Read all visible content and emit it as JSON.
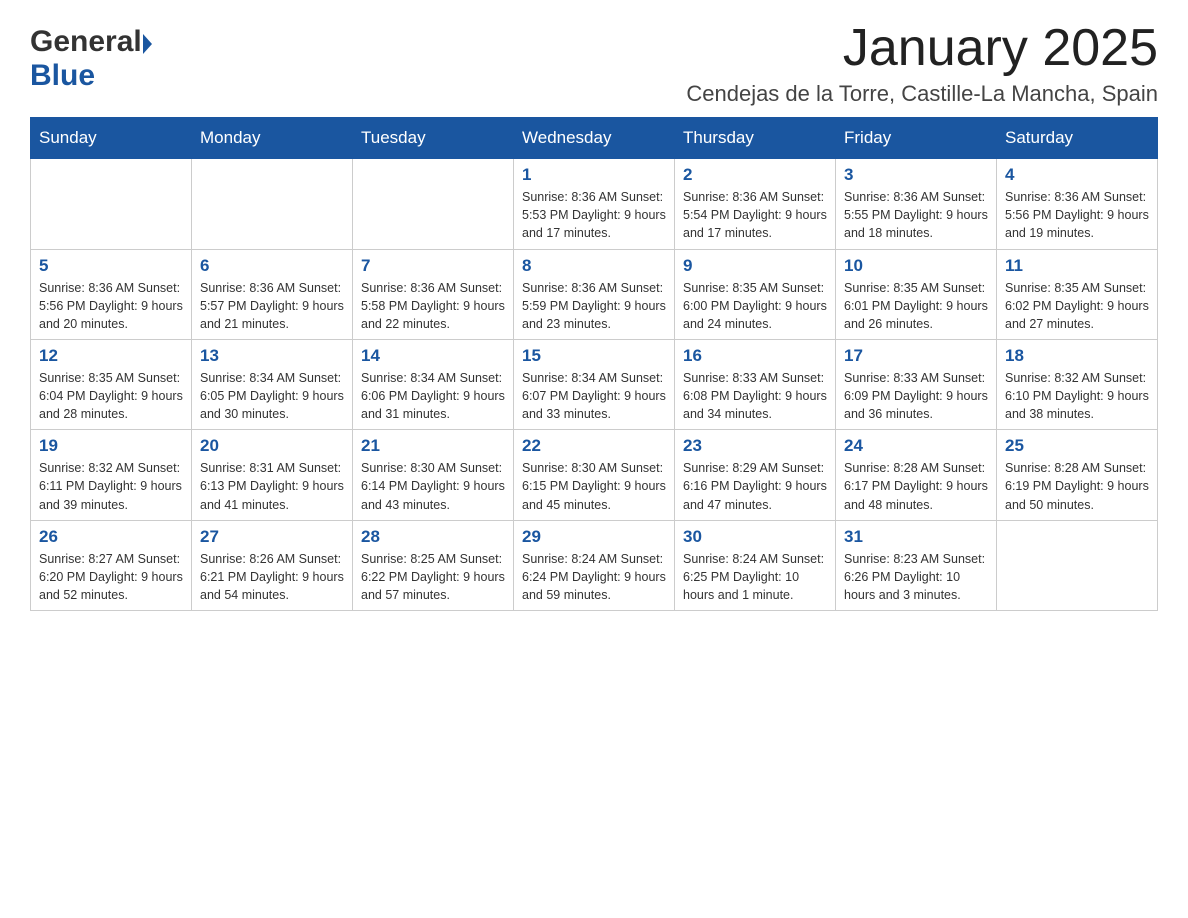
{
  "header": {
    "logo_general": "General",
    "logo_blue": "Blue",
    "month_title": "January 2025",
    "location": "Cendejas de la Torre, Castille-La Mancha, Spain"
  },
  "days_of_week": [
    "Sunday",
    "Monday",
    "Tuesday",
    "Wednesday",
    "Thursday",
    "Friday",
    "Saturday"
  ],
  "weeks": [
    [
      {
        "day": "",
        "info": ""
      },
      {
        "day": "",
        "info": ""
      },
      {
        "day": "",
        "info": ""
      },
      {
        "day": "1",
        "info": "Sunrise: 8:36 AM\nSunset: 5:53 PM\nDaylight: 9 hours\nand 17 minutes."
      },
      {
        "day": "2",
        "info": "Sunrise: 8:36 AM\nSunset: 5:54 PM\nDaylight: 9 hours\nand 17 minutes."
      },
      {
        "day": "3",
        "info": "Sunrise: 8:36 AM\nSunset: 5:55 PM\nDaylight: 9 hours\nand 18 minutes."
      },
      {
        "day": "4",
        "info": "Sunrise: 8:36 AM\nSunset: 5:56 PM\nDaylight: 9 hours\nand 19 minutes."
      }
    ],
    [
      {
        "day": "5",
        "info": "Sunrise: 8:36 AM\nSunset: 5:56 PM\nDaylight: 9 hours\nand 20 minutes."
      },
      {
        "day": "6",
        "info": "Sunrise: 8:36 AM\nSunset: 5:57 PM\nDaylight: 9 hours\nand 21 minutes."
      },
      {
        "day": "7",
        "info": "Sunrise: 8:36 AM\nSunset: 5:58 PM\nDaylight: 9 hours\nand 22 minutes."
      },
      {
        "day": "8",
        "info": "Sunrise: 8:36 AM\nSunset: 5:59 PM\nDaylight: 9 hours\nand 23 minutes."
      },
      {
        "day": "9",
        "info": "Sunrise: 8:35 AM\nSunset: 6:00 PM\nDaylight: 9 hours\nand 24 minutes."
      },
      {
        "day": "10",
        "info": "Sunrise: 8:35 AM\nSunset: 6:01 PM\nDaylight: 9 hours\nand 26 minutes."
      },
      {
        "day": "11",
        "info": "Sunrise: 8:35 AM\nSunset: 6:02 PM\nDaylight: 9 hours\nand 27 minutes."
      }
    ],
    [
      {
        "day": "12",
        "info": "Sunrise: 8:35 AM\nSunset: 6:04 PM\nDaylight: 9 hours\nand 28 minutes."
      },
      {
        "day": "13",
        "info": "Sunrise: 8:34 AM\nSunset: 6:05 PM\nDaylight: 9 hours\nand 30 minutes."
      },
      {
        "day": "14",
        "info": "Sunrise: 8:34 AM\nSunset: 6:06 PM\nDaylight: 9 hours\nand 31 minutes."
      },
      {
        "day": "15",
        "info": "Sunrise: 8:34 AM\nSunset: 6:07 PM\nDaylight: 9 hours\nand 33 minutes."
      },
      {
        "day": "16",
        "info": "Sunrise: 8:33 AM\nSunset: 6:08 PM\nDaylight: 9 hours\nand 34 minutes."
      },
      {
        "day": "17",
        "info": "Sunrise: 8:33 AM\nSunset: 6:09 PM\nDaylight: 9 hours\nand 36 minutes."
      },
      {
        "day": "18",
        "info": "Sunrise: 8:32 AM\nSunset: 6:10 PM\nDaylight: 9 hours\nand 38 minutes."
      }
    ],
    [
      {
        "day": "19",
        "info": "Sunrise: 8:32 AM\nSunset: 6:11 PM\nDaylight: 9 hours\nand 39 minutes."
      },
      {
        "day": "20",
        "info": "Sunrise: 8:31 AM\nSunset: 6:13 PM\nDaylight: 9 hours\nand 41 minutes."
      },
      {
        "day": "21",
        "info": "Sunrise: 8:30 AM\nSunset: 6:14 PM\nDaylight: 9 hours\nand 43 minutes."
      },
      {
        "day": "22",
        "info": "Sunrise: 8:30 AM\nSunset: 6:15 PM\nDaylight: 9 hours\nand 45 minutes."
      },
      {
        "day": "23",
        "info": "Sunrise: 8:29 AM\nSunset: 6:16 PM\nDaylight: 9 hours\nand 47 minutes."
      },
      {
        "day": "24",
        "info": "Sunrise: 8:28 AM\nSunset: 6:17 PM\nDaylight: 9 hours\nand 48 minutes."
      },
      {
        "day": "25",
        "info": "Sunrise: 8:28 AM\nSunset: 6:19 PM\nDaylight: 9 hours\nand 50 minutes."
      }
    ],
    [
      {
        "day": "26",
        "info": "Sunrise: 8:27 AM\nSunset: 6:20 PM\nDaylight: 9 hours\nand 52 minutes."
      },
      {
        "day": "27",
        "info": "Sunrise: 8:26 AM\nSunset: 6:21 PM\nDaylight: 9 hours\nand 54 minutes."
      },
      {
        "day": "28",
        "info": "Sunrise: 8:25 AM\nSunset: 6:22 PM\nDaylight: 9 hours\nand 57 minutes."
      },
      {
        "day": "29",
        "info": "Sunrise: 8:24 AM\nSunset: 6:24 PM\nDaylight: 9 hours\nand 59 minutes."
      },
      {
        "day": "30",
        "info": "Sunrise: 8:24 AM\nSunset: 6:25 PM\nDaylight: 10 hours\nand 1 minute."
      },
      {
        "day": "31",
        "info": "Sunrise: 8:23 AM\nSunset: 6:26 PM\nDaylight: 10 hours\nand 3 minutes."
      },
      {
        "day": "",
        "info": ""
      }
    ]
  ]
}
